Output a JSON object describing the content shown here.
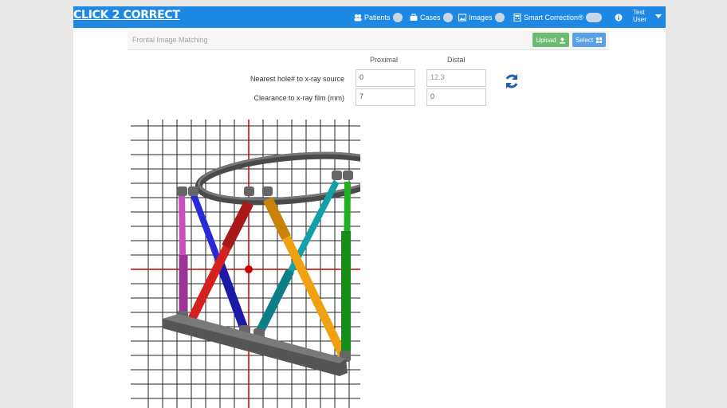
{
  "nav": {
    "brand": "CLICK 2 CORRECT",
    "items": [
      {
        "label": "Patients",
        "icon": "users-icon"
      },
      {
        "label": "Cases",
        "icon": "briefcase-icon"
      },
      {
        "label": "Images",
        "icon": "image-icon"
      },
      {
        "label": "Smart Correction®",
        "icon": "calculator-icon"
      }
    ],
    "info_icon": "info-icon",
    "user_line1": "Test",
    "user_line2": "User"
  },
  "panel": {
    "title": "Frontal Image Matching",
    "upload_label": "Upload",
    "select_label": "Select"
  },
  "form": {
    "col_proximal": "Proximal",
    "col_distal": "Distal",
    "row1_label": "Nearest hole# to x-ray source",
    "row2_label": "Clearance to x-ray film (mm)",
    "row1_proximal": "0",
    "row1_distal": "12.3",
    "row2_proximal": "7",
    "row2_distal": "0"
  },
  "colors": {
    "navbar": "#1e88e5",
    "strut_pink": "#c74fc0",
    "strut_blue": "#2a2ad8",
    "strut_red": "#d62020",
    "strut_teal": "#11a0a8",
    "strut_orange": "#f0a010",
    "strut_green": "#22b022",
    "grid_red": "#cc0000"
  }
}
